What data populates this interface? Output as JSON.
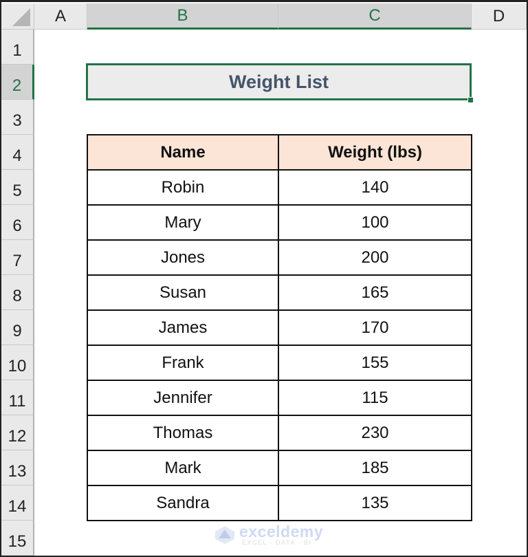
{
  "spreadsheet": {
    "columns": [
      {
        "label": "A",
        "selected": false
      },
      {
        "label": "B",
        "selected": true
      },
      {
        "label": "C",
        "selected": true
      },
      {
        "label": "D",
        "selected": false
      }
    ],
    "rows": [
      "1",
      "2",
      "3",
      "4",
      "5",
      "6",
      "7",
      "8",
      "9",
      "10",
      "11",
      "12",
      "13",
      "14",
      "15"
    ],
    "selected_row": "2",
    "active_cell_range": "B2:C2",
    "accent_color": "#217346"
  },
  "title": "Weight List",
  "table": {
    "headers": [
      "Name",
      "Weight (lbs)"
    ],
    "header_fill": "#fce4d6",
    "rows": [
      [
        "Robin",
        "140"
      ],
      [
        "Mary",
        "100"
      ],
      [
        "Jones",
        "200"
      ],
      [
        "Susan",
        "165"
      ],
      [
        "James",
        "170"
      ],
      [
        "Frank",
        "155"
      ],
      [
        "Jennifer",
        "115"
      ],
      [
        "Thomas",
        "230"
      ],
      [
        "Mark",
        "185"
      ],
      [
        "Sandra",
        "135"
      ]
    ]
  },
  "watermark": {
    "name": "exceldemy",
    "tagline": "EXCEL · DATA · BI"
  }
}
